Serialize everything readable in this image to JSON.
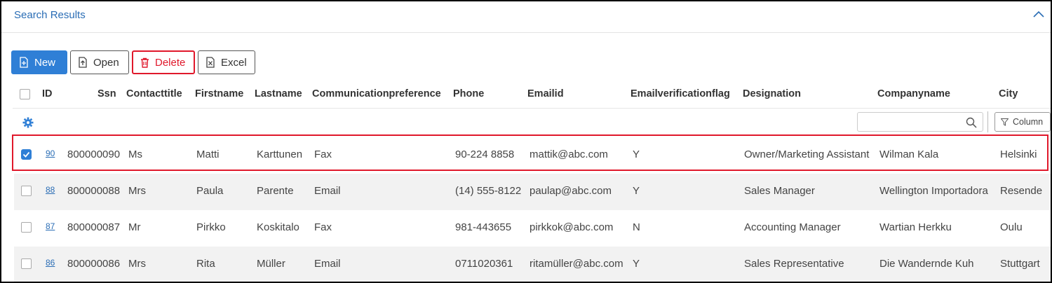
{
  "panel": {
    "title": "Search Results"
  },
  "toolbar": {
    "new_label": "New",
    "open_label": "Open",
    "delete_label": "Delete",
    "excel_label": "Excel"
  },
  "columns": [
    "ID",
    "Ssn",
    "Contacttitle",
    "Firstname",
    "Lastname",
    "Communicationpreference",
    "Phone",
    "Emailid",
    "Emailverificationflag",
    "Designation",
    "Companyname",
    "City"
  ],
  "filter": {
    "search_placeholder": "",
    "column_label": "Column"
  },
  "rows": [
    {
      "checked": true,
      "id": "90",
      "ssn": "800000090",
      "title": "Ms",
      "first": "Matti",
      "last": "Karttunen",
      "comm": "Fax",
      "phone": "90-224 8858",
      "email": "mattik@abc.com",
      "flag": "Y",
      "designation": "Owner/Marketing Assistant",
      "company": "Wilman Kala",
      "city": "Helsinki"
    },
    {
      "checked": false,
      "id": "88",
      "ssn": "800000088",
      "title": "Mrs",
      "first": "Paula",
      "last": "Parente",
      "comm": "Email",
      "phone": "(14) 555-8122",
      "email": "paulap@abc.com",
      "flag": "Y",
      "designation": "Sales Manager",
      "company": "Wellington Importadora",
      "city": "Resende"
    },
    {
      "checked": false,
      "id": "87",
      "ssn": "800000087",
      "title": "Mr",
      "first": "Pirkko",
      "last": "Koskitalo",
      "comm": "Fax",
      "phone": "981-443655",
      "email": "pirkkok@abc.com",
      "flag": "N",
      "designation": "Accounting Manager",
      "company": "Wartian Herkku",
      "city": "Oulu"
    },
    {
      "checked": false,
      "id": "86",
      "ssn": "800000086",
      "title": "Mrs",
      "first": "Rita",
      "last": "Müller",
      "comm": "Email",
      "phone": "0711020361",
      "email": "ritamüller@abc.com",
      "flag": "Y",
      "designation": "Sales Representative",
      "company": "Die Wandernde Kuh",
      "city": "Stuttgart"
    }
  ],
  "colors": {
    "accent": "#2f7fd6",
    "danger": "#e0182b",
    "title": "#2a6db5"
  }
}
